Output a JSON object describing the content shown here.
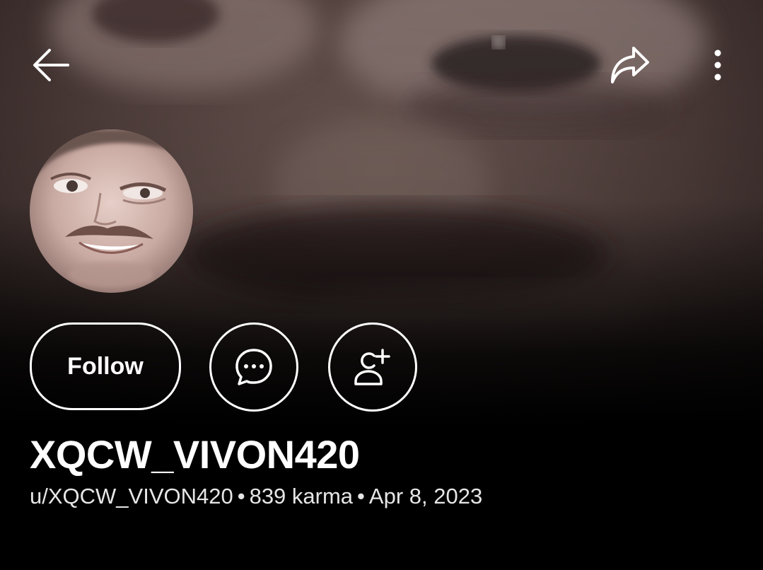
{
  "header": {
    "back_icon": "arrow-left-icon",
    "share_icon": "share-arrow-icon",
    "more_icon": "vertical-dots-icon"
  },
  "profile": {
    "banner_image": "blurred close-up face banner",
    "avatar_image": "face avatar",
    "display_name": "XQCW_VIVON420",
    "username": "u/XQCW_VIVON420",
    "karma": "839 karma",
    "separator": "•",
    "joined": "Apr 8, 2023"
  },
  "actions": {
    "follow_label": "Follow",
    "chat_icon": "chat-bubble-icon",
    "add_friend_icon": "add-person-icon"
  },
  "colors": {
    "background": "#000000",
    "text": "#ffffff",
    "meta_text": "#e6e6e6"
  }
}
